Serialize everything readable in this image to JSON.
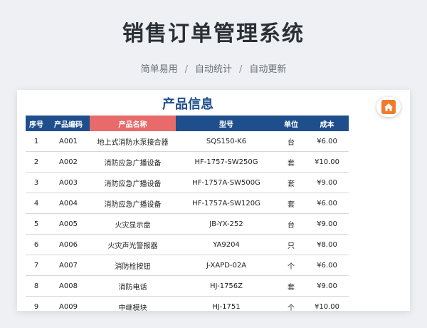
{
  "header": {
    "title": "销售订单管理系统",
    "subtitle_parts": [
      "简单易用",
      "自动统计",
      "自动更新"
    ],
    "separator": "/"
  },
  "panel": {
    "title": "产品信息",
    "home_icon": "home-icon",
    "accent_color": "#1e4f8c",
    "highlight_color": "#e86a6a",
    "home_button_color": "#f07b2b"
  },
  "table": {
    "columns": [
      "序号",
      "产品编码",
      "产品名称",
      "型号",
      "单位",
      "成本"
    ],
    "rows": [
      [
        "1",
        "A001",
        "地上式消防水泵接合器",
        "SQS150-K6",
        "台",
        "¥6.00"
      ],
      [
        "2",
        "A002",
        "消防应急广播设备",
        "HF-1757-SW250G",
        "套",
        "¥10.00"
      ],
      [
        "3",
        "A003",
        "消防应急广播设备",
        "HF-1757A-SW500G",
        "套",
        "¥9.00"
      ],
      [
        "4",
        "A004",
        "消防应急广播设备",
        "HF-1757A-SW120G",
        "套",
        "¥6.00"
      ],
      [
        "5",
        "A005",
        "火灾显示盘",
        "JB-YX-252",
        "台",
        "¥9.00"
      ],
      [
        "6",
        "A006",
        "火灾声光警报器",
        "YA9204",
        "只",
        "¥8.00"
      ],
      [
        "7",
        "A007",
        "消防栓按钮",
        "J-XAPD-02A",
        "个",
        "¥6.00"
      ],
      [
        "8",
        "A008",
        "消防电话",
        "HJ-1756Z",
        "套",
        "¥9.00"
      ],
      [
        "9",
        "A009",
        "中继模块",
        "HJ-1751",
        "个",
        "¥10.00"
      ]
    ]
  }
}
